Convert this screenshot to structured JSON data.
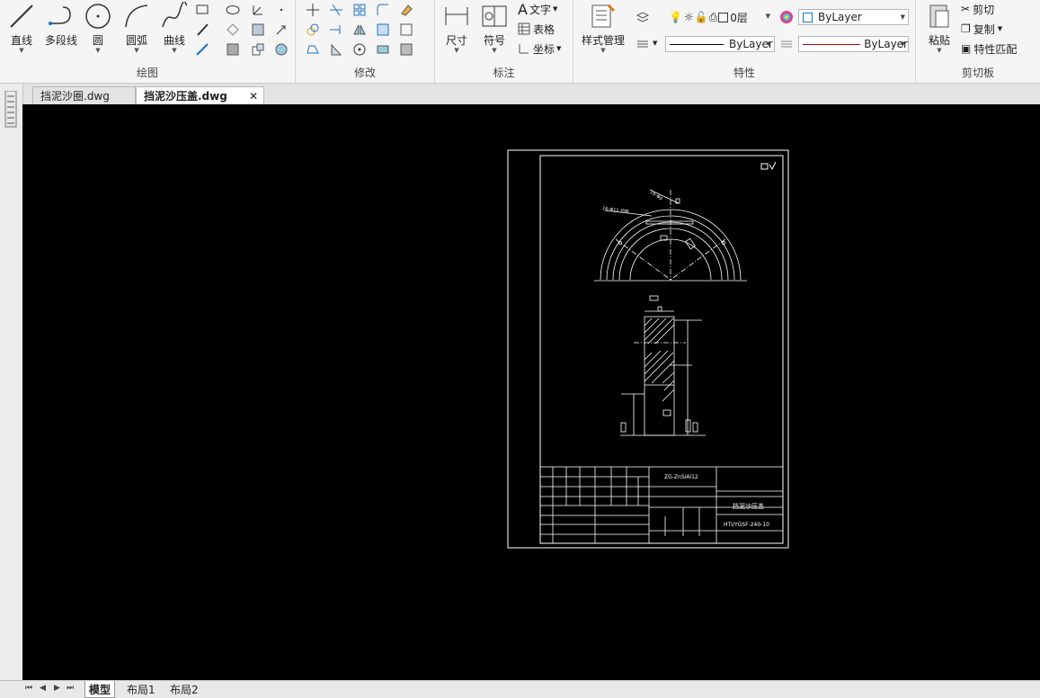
{
  "ribbon": {
    "draw_panel": {
      "title": "绘图",
      "line": "直线",
      "polyline": "多段线",
      "circle": "圆",
      "arc": "圆弧",
      "curve": "曲线"
    },
    "modify_panel": {
      "title": "修改"
    },
    "annotate_panel": {
      "title": "标注",
      "dimension": "尺寸",
      "symbol": "符号",
      "text": "文字",
      "table": "表格",
      "coordinate": "坐标"
    },
    "properties_panel": {
      "title": "特性",
      "style_manager": "样式管理",
      "layer_value": "0层",
      "color_value": "ByLayer",
      "linetype_value": "ByLayer",
      "lineweight_value": "ByLayer"
    },
    "clipboard_panel": {
      "title": "剪切板",
      "paste": "粘贴",
      "cut": "剪切",
      "copy": "复制",
      "match_props": "特性匹配"
    }
  },
  "document_tabs": [
    {
      "label": "挡泥沙圈.dwg",
      "active": false
    },
    {
      "label": "挡泥沙压盖.dwg",
      "active": true
    }
  ],
  "layout_tabs": [
    "模型",
    "布局1",
    "布局2"
  ],
  "drawing": {
    "part_name": "挡泥沙压盖",
    "drawing_number": "HTI/YGSF-240-10",
    "material": "ZG-ZnSiAl12"
  },
  "colors": {
    "canvas_bg": "#000000",
    "linetype_red": "#cc0000",
    "active_tab_bg": "#ffffff"
  }
}
